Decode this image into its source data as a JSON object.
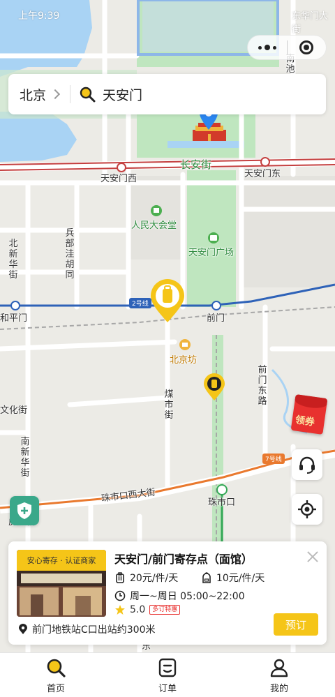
{
  "status": {
    "time": "上午9:39",
    "right_text": "东华门大街"
  },
  "search": {
    "city": "北京",
    "query": "天安门"
  },
  "map": {
    "labels": {
      "changan": "长安街",
      "tiananmen_west": "天安门西",
      "tiananmen_east": "天安门东",
      "great_hall": "人民大会堂",
      "square": "天安门广场",
      "bingbu": "兵部洼胡同",
      "beixinhua": "北新华街",
      "qianmen": "前门",
      "heping": "和平门",
      "beijingfang": "北京坊",
      "meishi": "煤市街",
      "qianmen_east": "前门东路",
      "wenhua": "文化街",
      "nanxinhua": "南新华街",
      "zhushikou_west": "珠市口西大街",
      "zhushikou": "珠市口",
      "hufang": "虎坊桥",
      "nanchi": "南池",
      "dong": "东"
    },
    "metro": {
      "line2": "2号线",
      "line7": "7号线"
    }
  },
  "coupon": {
    "label": "领券"
  },
  "card": {
    "tag": "安心寄存 · 认证商家",
    "title": "天安门/前门寄存点（面馆）",
    "price_luggage": "20元/件/天",
    "price_bag": "10元/件/天",
    "hours": "周一~周日 05:00~22:00",
    "rating": "5.0",
    "discount_tag": "多订特惠",
    "address": "前门地铁站C口出站约300米",
    "book_label": "预订"
  },
  "tabs": [
    {
      "label": "首页",
      "icon": "search-icon"
    },
    {
      "label": "订单",
      "icon": "order-icon"
    },
    {
      "label": "我的",
      "icon": "user-icon"
    }
  ],
  "colors": {
    "accent": "#f5c518",
    "green_area": "#bfe6bf",
    "water": "#a9d3f4",
    "changan_road": "#c43f3f",
    "metro_line2": "#2e62b8",
    "metro_line7": "#e9792e"
  }
}
